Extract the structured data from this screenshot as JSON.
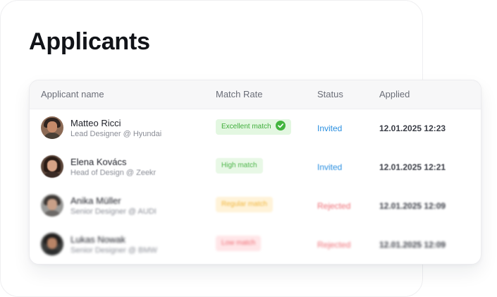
{
  "page": {
    "title": "Applicants"
  },
  "table": {
    "columns": [
      "Applicant name",
      "Match Rate",
      "Status",
      "Applied"
    ],
    "rows": [
      {
        "name": "Matteo Ricci",
        "role": "Lead Designer @ Hyundai",
        "match": "Excellent match",
        "match_icon": "check-circle-icon",
        "status": "Invited",
        "applied": "12.01.2025 12:23"
      },
      {
        "name": "Elena Kovács",
        "role": "Head of Design @ Zeekr",
        "match": "High match",
        "status": "Invited",
        "applied": "12.01.2025 12:21"
      },
      {
        "name": "Anika Müller",
        "role": "Senior Designer @ AUDI",
        "match": "Regular match",
        "status": "Rejected",
        "applied": "12.01.2025 12:09"
      },
      {
        "name": "Lukas Nowak",
        "role": "Senior Designer @ BMW",
        "match": "Low match",
        "status": "Rejected",
        "applied": "12.01.2025 12:09"
      }
    ]
  },
  "colors": {
    "excellent": "#43b53f",
    "invited": "#2a8fe0",
    "rejected": "#ee6a72",
    "regular": "#f0b43a"
  }
}
